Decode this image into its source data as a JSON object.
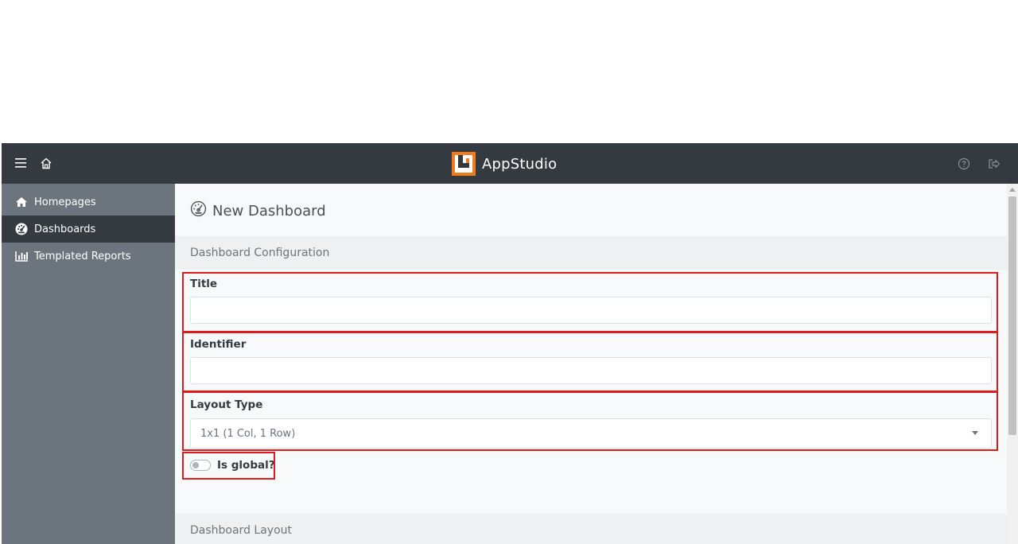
{
  "topbar": {
    "brand_name": "AppStudio",
    "left_icons": [
      "menu-icon",
      "home-icon"
    ],
    "right_icons": [
      "help-icon",
      "logout-icon"
    ],
    "accent_color": "#f07c1b"
  },
  "sidebar": {
    "items": [
      {
        "label": "Homepages",
        "icon": "home-icon",
        "active": false
      },
      {
        "label": "Dashboards",
        "icon": "dashboard-icon",
        "active": true
      },
      {
        "label": "Templated Reports",
        "icon": "bar-chart-icon",
        "active": false
      }
    ]
  },
  "main": {
    "page_title": "New Dashboard",
    "config_section": "Dashboard Configuration",
    "title_label": "Title",
    "title_value": "",
    "identifier_label": "Identifier",
    "identifier_value": "",
    "layout_label": "Layout Type",
    "layout_value": "1x1 (1 Col, 1 Row)",
    "global_label": "Is global?",
    "global_on": false,
    "layout_section": "Dashboard Layout"
  }
}
